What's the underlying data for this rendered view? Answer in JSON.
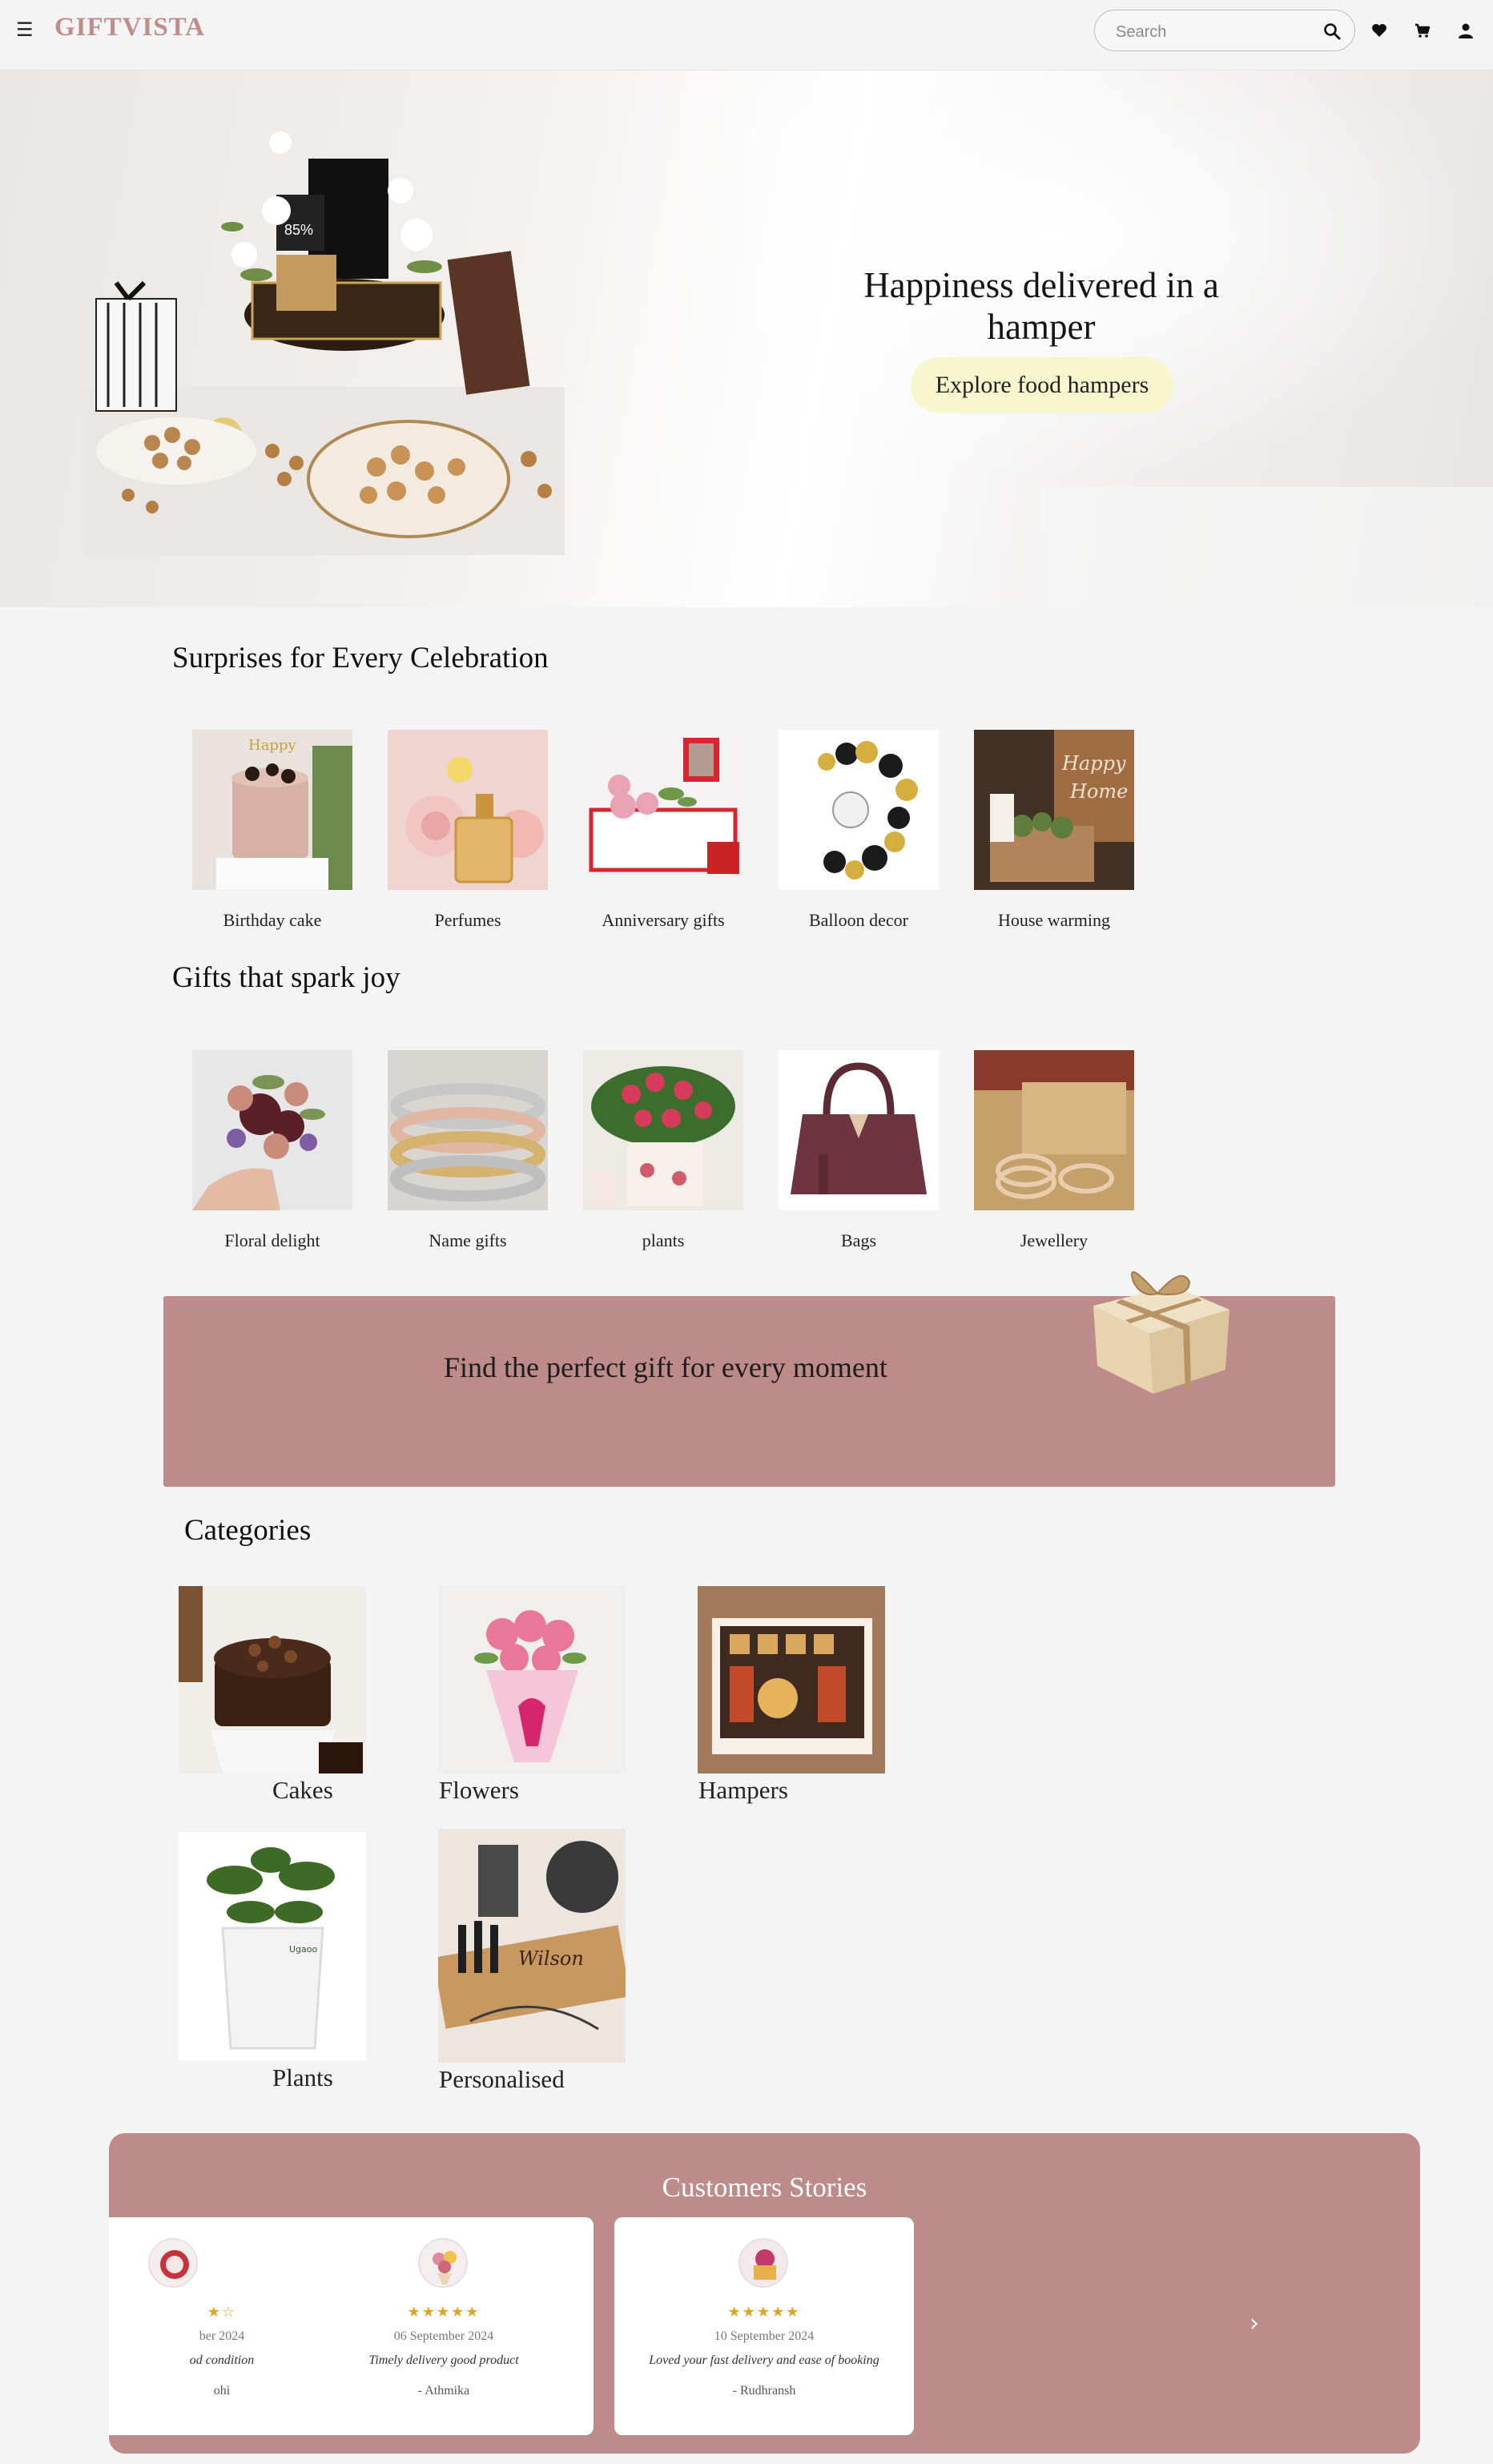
{
  "header": {
    "logo": "GIFTVISTA",
    "search_placeholder": "Search",
    "icons": [
      "menu-icon",
      "search-icon",
      "heart-icon",
      "cart-icon",
      "user-icon"
    ]
  },
  "hero": {
    "title": "Happiness delivered in a hamper",
    "button": "Explore food hampers"
  },
  "celebrations": {
    "title": "Surprises for Every Celebration",
    "items": [
      {
        "label": "Birthday cake"
      },
      {
        "label": "Perfumes"
      },
      {
        "label": "Anniversary gifts"
      },
      {
        "label": "Balloon decor"
      },
      {
        "label": "House warming"
      }
    ]
  },
  "joy": {
    "title": "Gifts that spark joy",
    "items": [
      {
        "label": "Floral delight"
      },
      {
        "label": "Name gifts"
      },
      {
        "label": "plants"
      },
      {
        "label": "Bags"
      },
      {
        "label": "Jewellery"
      }
    ]
  },
  "banner": {
    "text": "Find the perfect gift for every moment"
  },
  "categories": {
    "title": "Categories",
    "items": [
      {
        "label": "Cakes"
      },
      {
        "label": "Flowers"
      },
      {
        "label": "Hampers"
      },
      {
        "label": "Plants"
      },
      {
        "label": "Personalised"
      }
    ]
  },
  "stories": {
    "title": "Customers Stories",
    "prev": "‹",
    "next": "›",
    "cards": [
      {
        "stars": "★☆",
        "date": "ber 2024",
        "message": "od condition",
        "name": "ohi"
      },
      {
        "stars": "★★★★★",
        "date": "06 September 2024",
        "message": "Timely delivery good product",
        "name": "- Athmika"
      },
      {
        "stars": "★★★★★",
        "date": "10 September 2024",
        "message": "Loved your fast delivery and ease of booking",
        "name": "- Rudhransh"
      }
    ]
  },
  "colors": {
    "brand": "#c08d8b",
    "banner": "#bd8b8a",
    "hero_button": "#f8f6cf",
    "stars": "#e0a423"
  }
}
